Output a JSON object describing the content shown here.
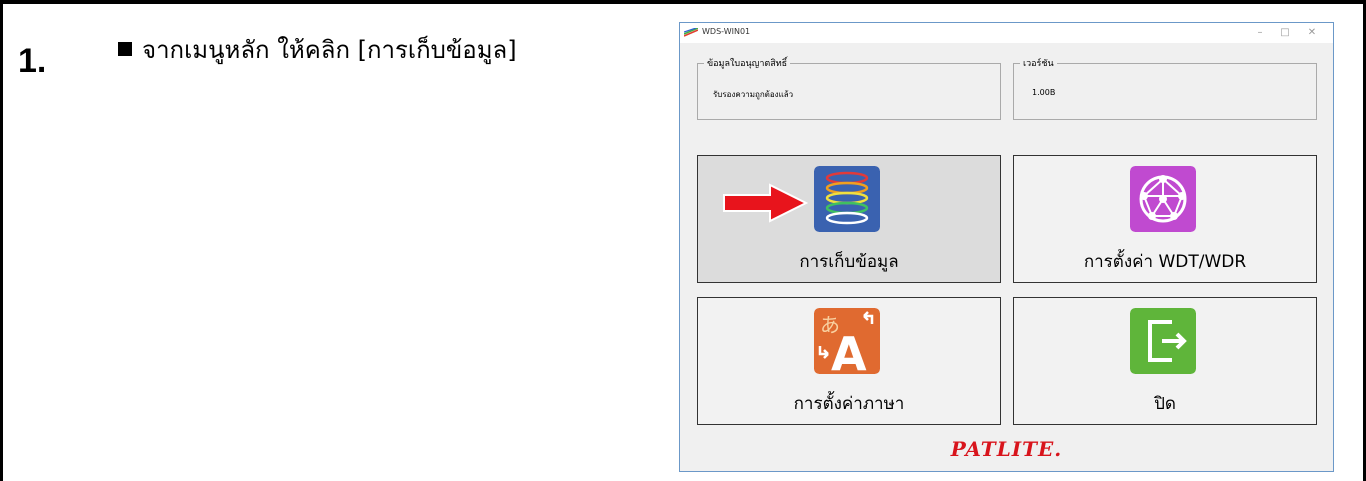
{
  "instruction": {
    "step_number": "1.",
    "text": "จากเมนูหลัก  ให้คลิก  [การเก็บข้อมูล]"
  },
  "window": {
    "title": "WDS-WIN01",
    "controls": {
      "minimize": "–",
      "maximize": "□",
      "close": "✕"
    },
    "license_group": {
      "legend": "ข้อมูลใบอนุญาตสิทธิ์",
      "value": "รับรองความถูกต้องแล้ว"
    },
    "version_group": {
      "legend": "เวอร์ชัน",
      "value": "1.00B"
    },
    "tiles": [
      {
        "label": "การเก็บข้อมูล",
        "icon": "data-collection-rings-icon",
        "selected": true
      },
      {
        "label": "การตั้งค่า WDT/WDR",
        "icon": "network-sphere-icon",
        "selected": false
      },
      {
        "label": "การตั้งค่าภาษา",
        "icon": "language-icon",
        "selected": false
      },
      {
        "label": "ปิด",
        "icon": "exit-icon",
        "selected": false
      }
    ],
    "logo": "PATLITE."
  },
  "colors": {
    "arrow": "#e8141c",
    "logo": "#d8141c"
  }
}
